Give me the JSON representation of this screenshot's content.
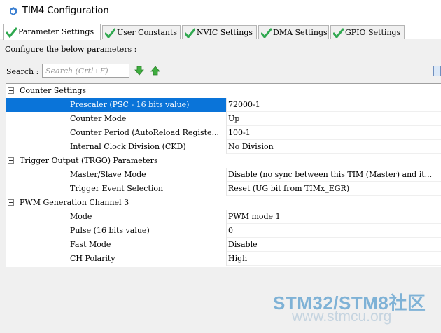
{
  "window": {
    "title": "TIM4 Configuration"
  },
  "tabs": [
    {
      "label": "Parameter Settings",
      "active": true
    },
    {
      "label": "User Constants",
      "active": false
    },
    {
      "label": "NVIC Settings",
      "active": false
    },
    {
      "label": "DMA Settings",
      "active": false
    },
    {
      "label": "GPIO Settings",
      "active": false
    }
  ],
  "panel": {
    "configure_text": "Configure the below parameters :",
    "search_label": "Search :",
    "search_placeholder": "Search (Crtl+F)"
  },
  "sections": [
    {
      "title": "Counter Settings",
      "params": [
        {
          "name": "Prescaler (PSC - 16 bits value)",
          "value": "72000-1",
          "selected": true
        },
        {
          "name": "Counter Mode",
          "value": "Up"
        },
        {
          "name": "Counter Period (AutoReload Registe...",
          "value": "100-1"
        },
        {
          "name": "Internal Clock Division (CKD)",
          "value": "No Division"
        }
      ]
    },
    {
      "title": "Trigger Output (TRGO) Parameters",
      "params": [
        {
          "name": "Master/Slave Mode",
          "value": "Disable (no sync between this TIM (Master) and it..."
        },
        {
          "name": "Trigger Event Selection",
          "value": "Reset (UG bit from TIMx_EGR)"
        }
      ]
    },
    {
      "title": "PWM Generation Channel 3",
      "params": [
        {
          "name": "Mode",
          "value": "PWM mode 1"
        },
        {
          "name": "Pulse (16 bits value)",
          "value": "0"
        },
        {
          "name": "Fast Mode",
          "value": "Disable"
        },
        {
          "name": "CH Polarity",
          "value": "High"
        }
      ]
    }
  ],
  "watermark": {
    "main": "STM32/STM8社区",
    "sub": "www.stmcu.org"
  },
  "colors": {
    "selection": "#0a74d9",
    "check_green": "#2fa84f",
    "watermark_blue": "#7fb2d6"
  }
}
